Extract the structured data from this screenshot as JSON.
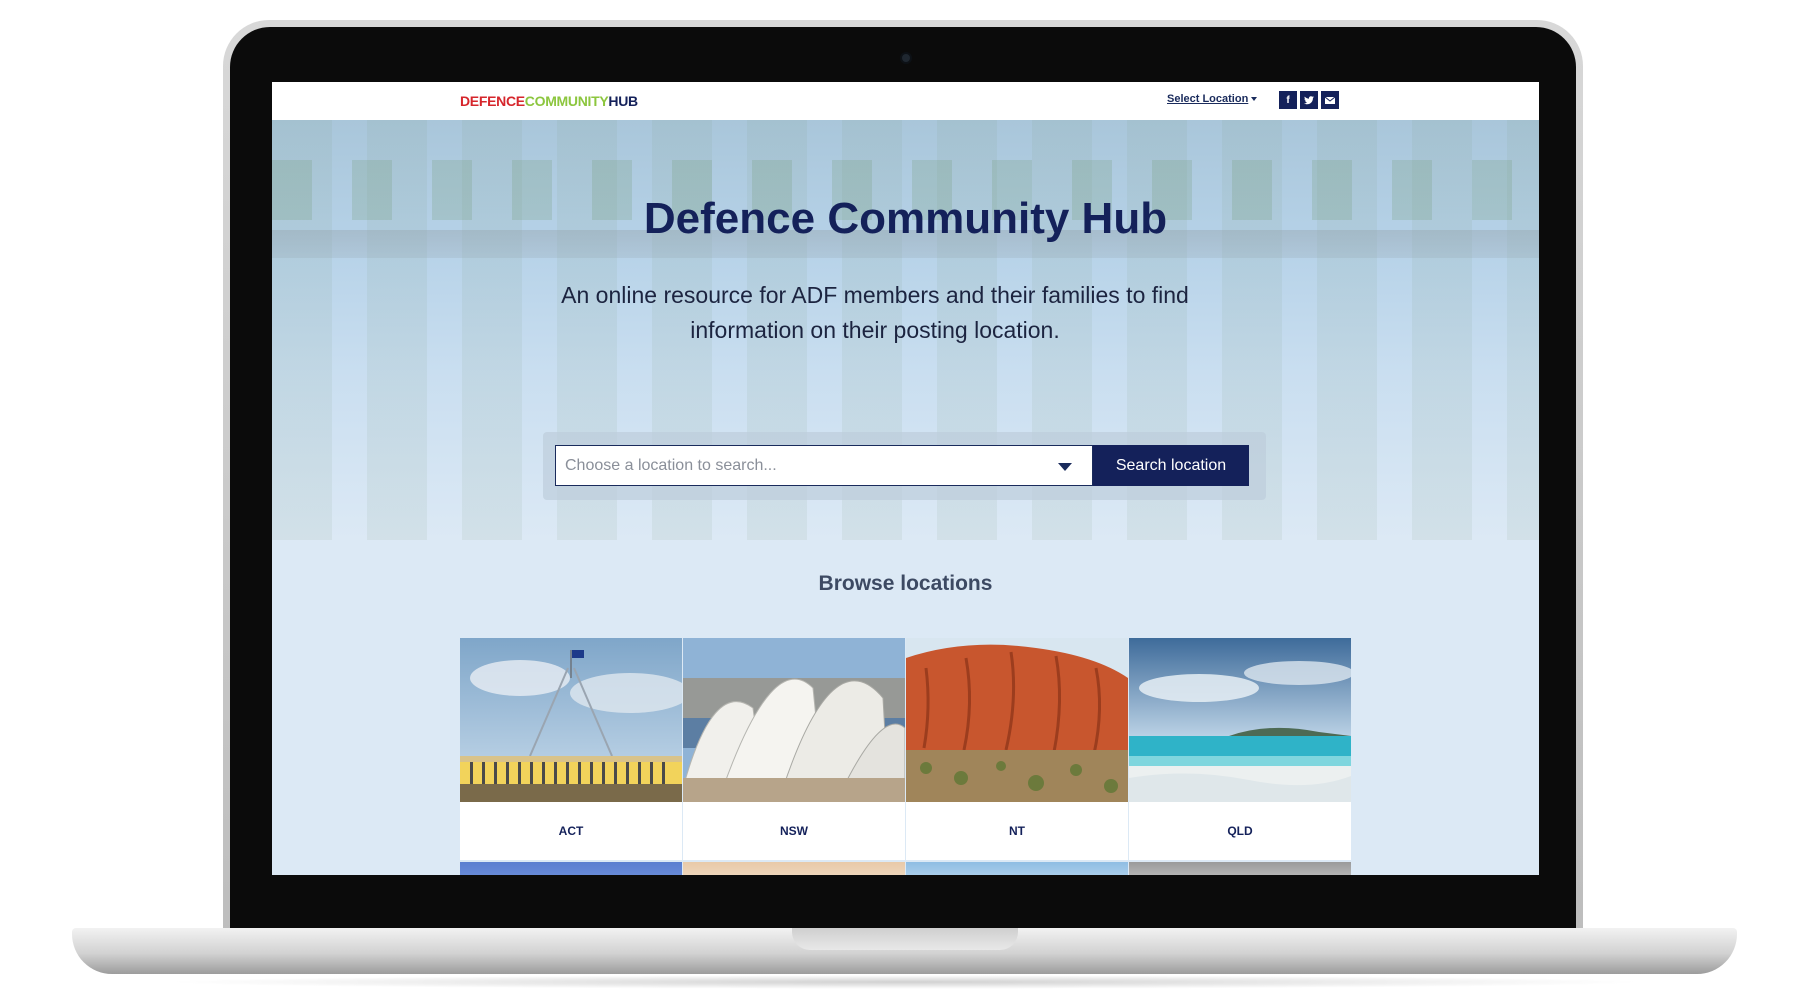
{
  "brand": {
    "logo_word_1": "DEFENCE",
    "logo_word_2": "COMMUNITY",
    "logo_word_3": "HUB",
    "colors": {
      "red": "#d6262c",
      "green": "#8cc63e",
      "navy": "#14215a"
    }
  },
  "header": {
    "select_location_label": "Select Location",
    "social": [
      {
        "icon": "facebook-icon",
        "glyph": "f"
      },
      {
        "icon": "twitter-icon",
        "glyph": "t"
      },
      {
        "icon": "email-icon",
        "glyph": "✉"
      }
    ]
  },
  "hero": {
    "title": "Defence Community Hub",
    "subtitle": "An online resource for ADF members and their families to find information on their posting location."
  },
  "search": {
    "placeholder": "Choose a location to search...",
    "button_label": "Search location"
  },
  "browse": {
    "title": "Browse locations",
    "locations": [
      {
        "label": "ACT",
        "image": "parliament-house"
      },
      {
        "label": "NSW",
        "image": "sydney-opera-house"
      },
      {
        "label": "NT",
        "image": "uluru"
      },
      {
        "label": "QLD",
        "image": "whitehaven-beach"
      }
    ]
  }
}
